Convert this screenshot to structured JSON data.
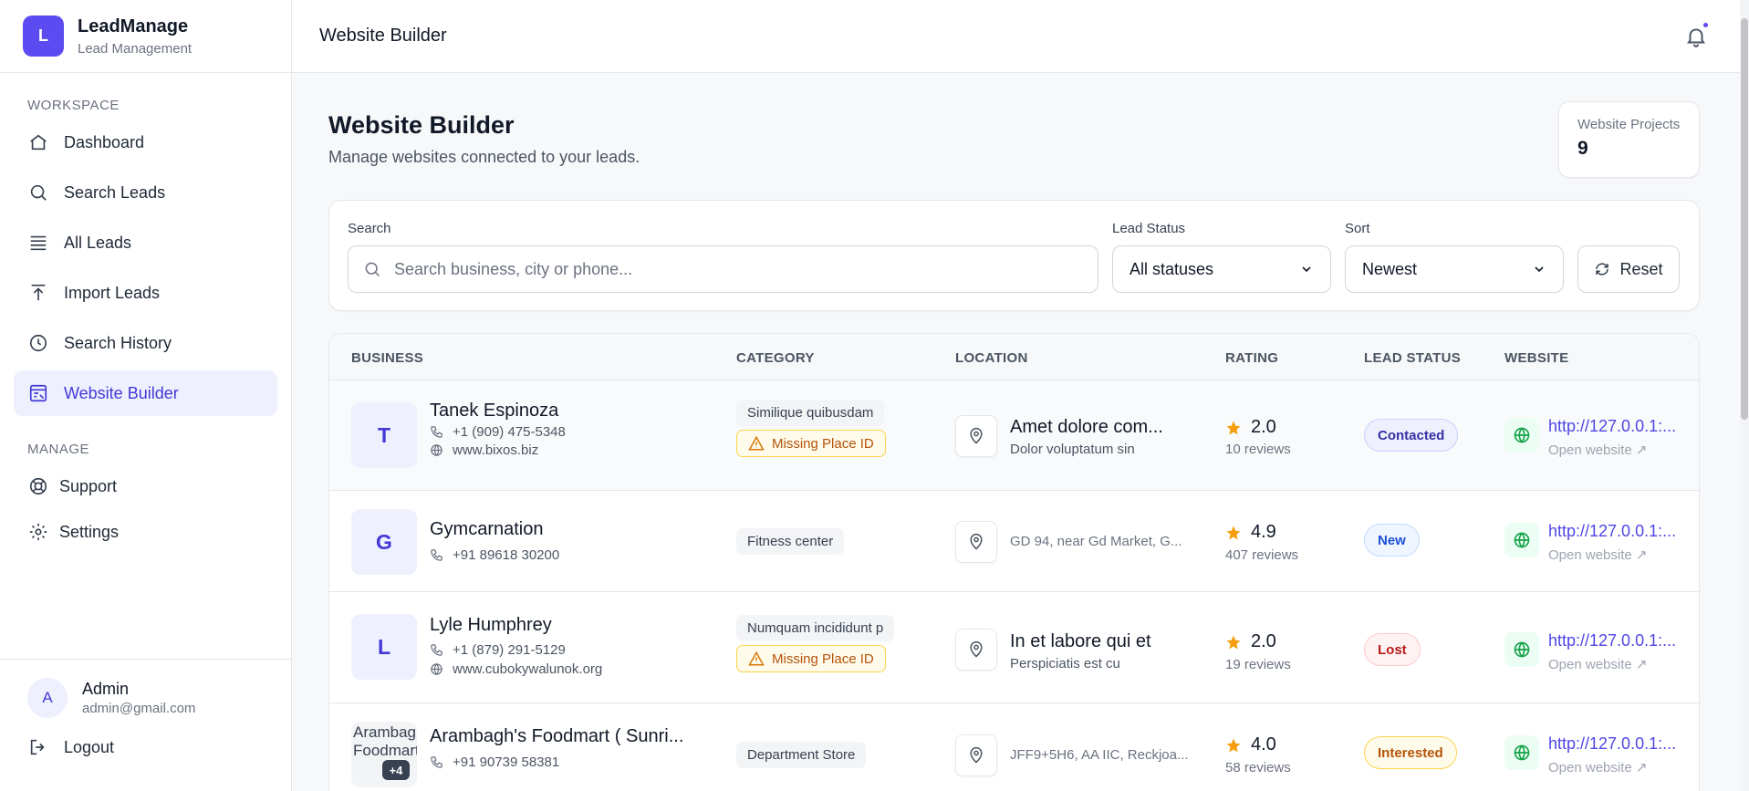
{
  "brand": {
    "logo_letter": "L",
    "name": "LeadManage",
    "subtitle": "Lead Management"
  },
  "sidebar": {
    "workspace_label": "WORKSPACE",
    "workspace_items": [
      {
        "label": "Dashboard",
        "icon": "home-icon"
      },
      {
        "label": "Search Leads",
        "icon": "search-icon"
      },
      {
        "label": "All Leads",
        "icon": "list-icon"
      },
      {
        "label": "Import Leads",
        "icon": "upload-icon"
      },
      {
        "label": "Search History",
        "icon": "clock-icon"
      },
      {
        "label": "Website Builder",
        "icon": "builder-icon",
        "active": true
      }
    ],
    "manage_label": "MANAGE",
    "manage_items": [
      {
        "label": "Support",
        "icon": "lifebuoy-icon"
      },
      {
        "label": "Settings",
        "icon": "gear-icon"
      }
    ],
    "user": {
      "initial": "A",
      "name": "Admin",
      "email": "admin@gmail.com"
    },
    "logout_label": "Logout"
  },
  "header": {
    "title": "Website Builder",
    "notification_icon": "bell-icon"
  },
  "page": {
    "title": "Website Builder",
    "subtitle": "Manage websites connected to your leads.",
    "stat": {
      "label": "Website Projects",
      "value": "9"
    }
  },
  "filters": {
    "search_label": "Search",
    "search_placeholder": "Search business, city or phone...",
    "search_value": "",
    "status_label": "Lead Status",
    "status_value": "All statuses",
    "sort_label": "Sort",
    "sort_value": "Newest",
    "reset_label": "Reset"
  },
  "table": {
    "columns": [
      "BUSINESS",
      "CATEGORY",
      "LOCATION",
      "RATING",
      "LEAD STATUS",
      "WEBSITE"
    ],
    "rows": [
      {
        "initial": "T",
        "name": "Tanek Espinoza",
        "phone": "+1 (909) 475-5348",
        "site": "www.bixos.biz",
        "category": "Similique quibusdam",
        "warning": "Missing Place ID",
        "location_main": "Amet dolore com...",
        "location_sub": "Dolor voluptatum sin",
        "rating": "2.0",
        "reviews": "10 reviews",
        "status": "Contacted",
        "website": "http://127.0.0.1:...",
        "open_label": "Open website ↗"
      },
      {
        "initial": "G",
        "name": "Gymcarnation",
        "phone": "+91 89618 30200",
        "category": "Fitness center",
        "location_single": "GD 94, near Gd Market, G...",
        "rating": "4.9",
        "reviews": "407 reviews",
        "status": "New",
        "website": "http://127.0.0.1:...",
        "open_label": "Open website ↗"
      },
      {
        "initial": "L",
        "name": "Lyle Humphrey",
        "phone": "+1 (879) 291-5129",
        "site": "www.cubokywalunok.org",
        "category": "Numquam incididunt p",
        "warning": "Missing Place ID",
        "location_main": "In et labore qui et",
        "location_sub": "Perspiciatis est cu",
        "rating": "2.0",
        "reviews": "19 reviews",
        "status": "Lost",
        "website": "http://127.0.0.1:...",
        "open_label": "Open website ↗"
      },
      {
        "image_alt": "Arambagh's Foodmart",
        "extra_images": "+4",
        "name": "Arambagh's Foodmart ( Sunri...",
        "phone": "+91 90739 58381",
        "category": "Department Store",
        "location_single": "JFF9+5H6, AA IIC, Reckjoa...",
        "rating": "4.0",
        "reviews": "58 reviews",
        "status": "Interested",
        "website": "http://127.0.0.1:...",
        "open_label": "Open website ↗"
      }
    ]
  },
  "colors": {
    "accent": "#5b4bf0",
    "contacted_bg": "#eef0fe",
    "contacted_fg": "#3730a3",
    "new_bg": "#eff6ff",
    "new_fg": "#1d4ed8",
    "lost_bg": "#fef2f2",
    "lost_fg": "#b91c1c",
    "interested_bg": "#fffbeb",
    "interested_fg": "#b45309",
    "star": "#f59e0b",
    "globe": "#16a34a"
  }
}
